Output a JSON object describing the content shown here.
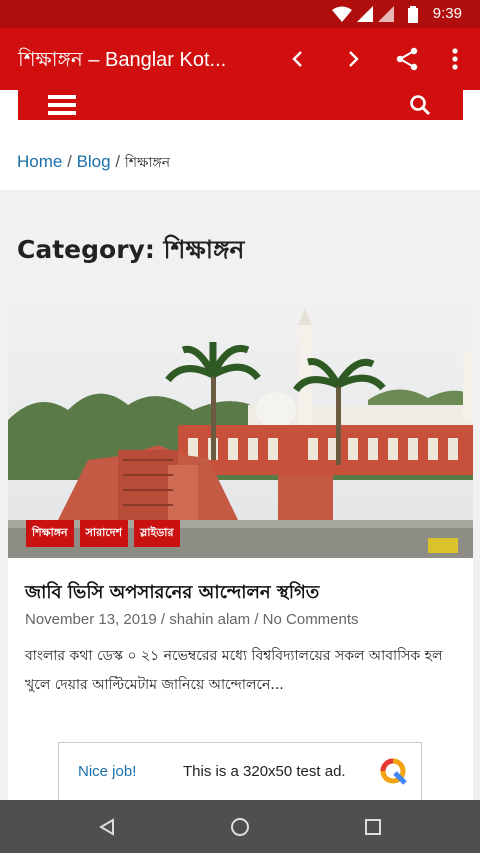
{
  "status_bar": {
    "time": "9:39",
    "icons": [
      "wifi-icon",
      "signal-icon",
      "signal-icon",
      "battery-icon"
    ]
  },
  "toolbar": {
    "title": "শিক্ষাঙ্গন – Banglar Kot...",
    "icons": [
      "back-icon",
      "forward-icon",
      "share-icon",
      "more-icon"
    ]
  },
  "site_menu": {
    "icons": [
      "hamburger-menu-icon",
      "search-icon"
    ]
  },
  "breadcrumb": {
    "home": "Home",
    "sep1": "/",
    "blog": "Blog",
    "sep2": "/",
    "current": "শিক্ষাঙ্গন"
  },
  "category": {
    "title": "Category: শিক্ষাঙ্গন"
  },
  "post": {
    "tags": [
      "শিক্ষাঙ্গন",
      "সারাদেশ",
      "স্লাইডার"
    ],
    "title": "জাবি ভিসি অপসারনের আন্দোলন স্থগিত",
    "date": "November 13, 2019",
    "meta_sep1": "/",
    "author": "shahin alam",
    "meta_sep2": "/",
    "comments": "No Comments",
    "excerpt": "বাংলার কথা ডেস্ক ০ ২১ নভেম্বরের মধ্যে বিশ্ববিদ্যালয়ের সকল আবাসিক হল খুলে দেয়ার আল্টিমেটাম জানিয়ে আন্দোলনে..."
  },
  "ad": {
    "label": "Nice job!",
    "message": "This is a 320x50 test ad."
  },
  "nav_bar": {
    "icons": [
      "back-nav-icon",
      "home-nav-icon",
      "recents-nav-icon"
    ]
  },
  "colors": {
    "brand": "#d10f0f",
    "status_bar": "#b00d0d",
    "link": "#1a6fa8",
    "tag": "#c9120f"
  }
}
